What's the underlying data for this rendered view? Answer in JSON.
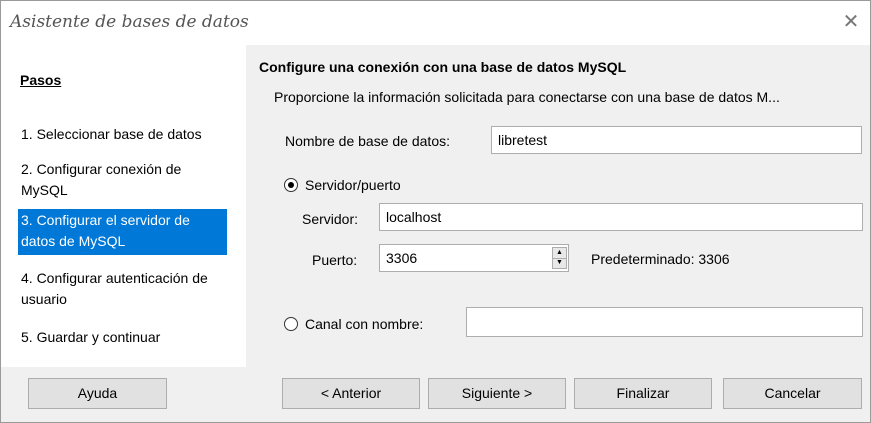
{
  "window": {
    "title": "Asistente de bases de datos",
    "close_glyph": "✕"
  },
  "sidebar": {
    "title": "Pasos",
    "steps": [
      {
        "label": "1. Seleccionar base de datos",
        "active": false
      },
      {
        "label": "2. Configurar conexión de MySQL",
        "active": false
      },
      {
        "label": "3. Configurar el servidor de datos de MySQL",
        "active": true
      },
      {
        "label": "4. Configurar autenticación de usuario",
        "active": false
      },
      {
        "label": "5. Guardar y continuar",
        "active": false
      }
    ]
  },
  "main": {
    "heading": "Configure una conexión con una base de datos MySQL",
    "description": "Proporcione la información solicitada para conectarse con una base de datos M...",
    "db_name": {
      "label": "Nombre de base de datos:",
      "value": "libretest"
    },
    "server_port_option": {
      "label": "Servidor/puerto",
      "checked": true
    },
    "server": {
      "label": "Servidor:",
      "value": "localhost"
    },
    "port": {
      "label": "Puerto:",
      "value": "3306",
      "default_text": "Predeterminado: 3306"
    },
    "named_pipe_option": {
      "label": "Canal con nombre:",
      "checked": false,
      "value": ""
    }
  },
  "buttons": {
    "help": "Ayuda",
    "back": "< Anterior",
    "next": "Siguiente >",
    "finish": "Finalizar",
    "cancel": "Cancelar"
  }
}
